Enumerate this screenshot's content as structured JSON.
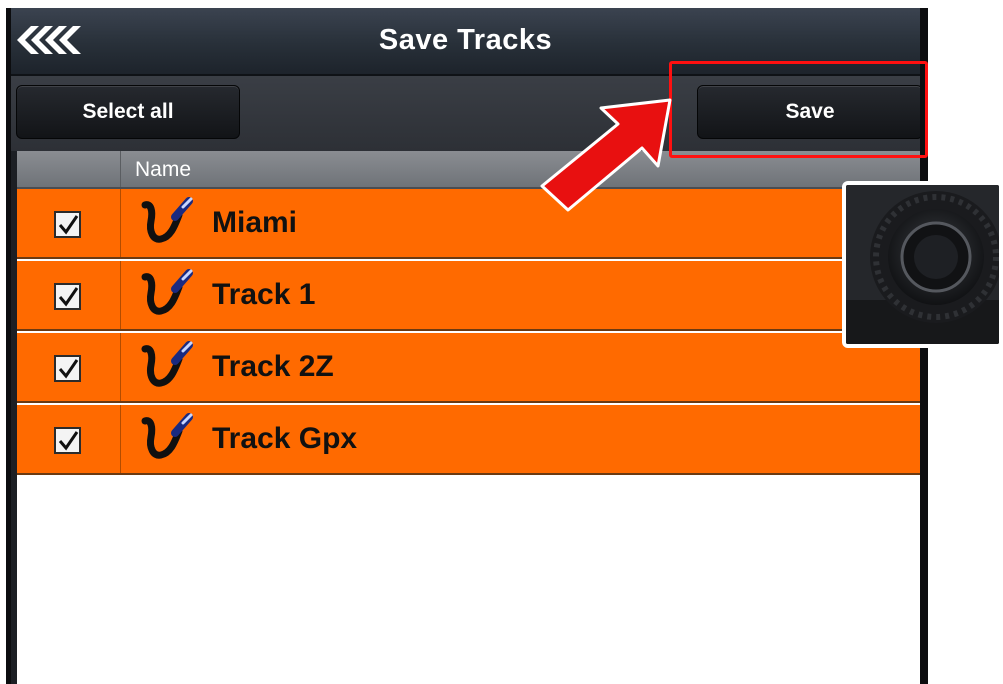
{
  "app": {
    "title": "Save Tracks"
  },
  "toolbar": {
    "select_all_label": "Select all",
    "save_label": "Save"
  },
  "table": {
    "name_header": "Name",
    "rows": [
      {
        "name": "Miami",
        "checked": true,
        "icon": "track-icon"
      },
      {
        "name": "Track 1",
        "checked": true,
        "icon": "track-icon"
      },
      {
        "name": "Track 2Z",
        "checked": true,
        "icon": "track-icon"
      },
      {
        "name": "Track Gpx",
        "checked": true,
        "icon": "track-icon"
      }
    ]
  },
  "colors": {
    "row_selected": "#ff6a00",
    "annotation": "#ff1010",
    "titlebar": "#2b333d"
  },
  "icons": {
    "back": "back-chevrons-icon",
    "checkbox": "checkmark-icon",
    "callout": "red-arrow-icon",
    "hardware": "rotary-knob-icon"
  }
}
